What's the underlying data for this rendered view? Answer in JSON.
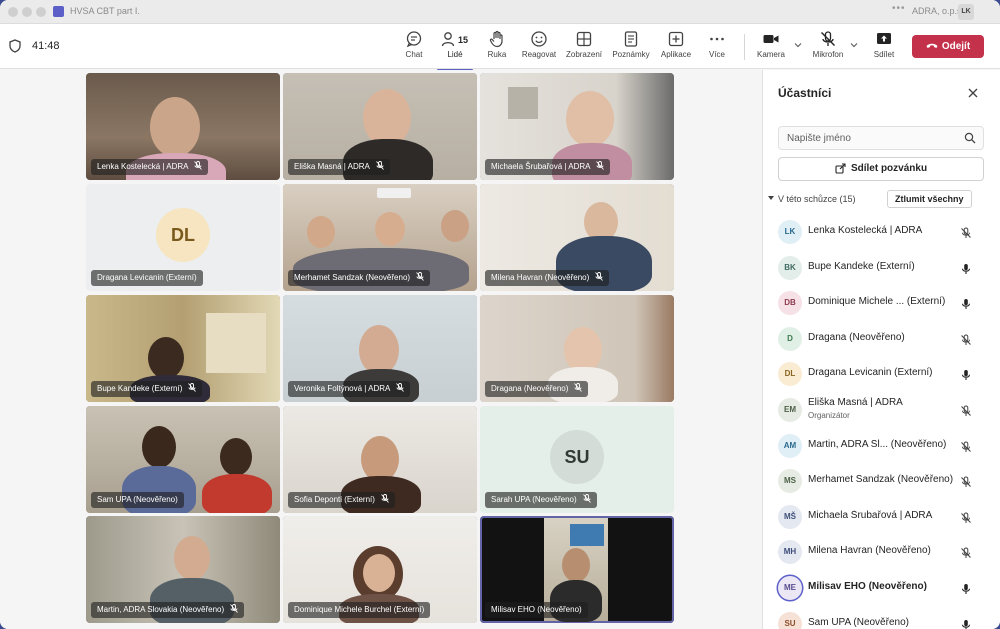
{
  "titlebar": {
    "title": "HVSA CBT part I.",
    "org": "ADRA, o.p.s.",
    "avatar": "LK"
  },
  "toolbar": {
    "timer": "41:48",
    "buttons": {
      "chat": "Chat",
      "people": "Lidé",
      "people_count": "15",
      "raise": "Ruka",
      "react": "Reagovat",
      "view": "Zobrazení",
      "notes": "Poznámky",
      "apps": "Aplikace",
      "more": "Více",
      "camera": "Kamera",
      "mic": "Mikrofon",
      "share": "Sdílet",
      "leave": "Odejít"
    }
  },
  "colors": {
    "accent": "#5b5fc7",
    "leave": "#c4314b",
    "active_speaker_border": "#6264a7"
  },
  "tiles": [
    {
      "name": "Lenka Kostelecká | ADRA",
      "mic": "muted"
    },
    {
      "name": "Eliška Masná | ADRA",
      "mic": "muted"
    },
    {
      "name": "Michaela Šrubařová | ADRA",
      "mic": "muted"
    },
    {
      "name": "Dragana Levicanin (Externí)",
      "mic": "none",
      "initials": "DL"
    },
    {
      "name": "Merhamet Sandzak (Neověřeno)",
      "mic": "muted"
    },
    {
      "name": "Milena Havran (Neověřeno)",
      "mic": "muted"
    },
    {
      "name": "Bupe Kandeke (Externí)",
      "mic": "muted"
    },
    {
      "name": "Veronika Foltýnová | ADRA",
      "mic": "muted"
    },
    {
      "name": "Dragana (Neověřeno)",
      "mic": "muted"
    },
    {
      "name": "Sam UPA (Neověřeno)",
      "mic": "none"
    },
    {
      "name": "Sofia Deponti (Externí)",
      "mic": "muted"
    },
    {
      "name": "Sarah UPA (Neověřeno)",
      "mic": "muted",
      "initials": "SU"
    },
    {
      "name": "Martin, ADRA Slovakia (Neověřeno)",
      "mic": "muted"
    },
    {
      "name": "Dominique Michele Burchel (Externí)",
      "mic": "none"
    },
    {
      "name": "Milisav EHO (Neověřeno)",
      "mic": "none"
    }
  ],
  "panel": {
    "title": "Účastníci",
    "search_placeholder": "Napište jméno",
    "share_invite": "Sdílet pozvánku",
    "section_label": "V této schůzce (15)",
    "mute_all": "Ztlumit všechny",
    "participants": [
      {
        "initials": "LK",
        "name": "Lenka Kostelecká | ADRA",
        "mic": "muted",
        "color": "#e0eef6",
        "text_color": "#2b6a8e"
      },
      {
        "initials": "BK",
        "name": "Bupe Kandeke (Externí)",
        "mic": "on",
        "color": "#e3eeeb",
        "text_color": "#3f6a5f"
      },
      {
        "initials": "DB",
        "name": "Dominique Michele ... (Externí)",
        "mic": "on",
        "color": "#f6e1e6",
        "text_color": "#8e3b4f"
      },
      {
        "initials": "D",
        "name": "Dragana (Neověřeno)",
        "mic": "muted",
        "color": "#e1f0e6",
        "text_color": "#3b7a4f"
      },
      {
        "initials": "DL",
        "name": "Dragana Levicanin (Externí)",
        "mic": "on",
        "color": "#f9ecd2",
        "text_color": "#8a6420"
      },
      {
        "initials": "EM",
        "name": "Eliška Masná | ADRA",
        "role": "Organizátor",
        "mic": "muted",
        "color": "#e6ebe4",
        "text_color": "#4d5f47"
      },
      {
        "initials": "AM",
        "name": "Martin, ADRA Sl... (Neověřeno)",
        "mic": "muted",
        "color": "#e0eef6",
        "text_color": "#2b6a8e"
      },
      {
        "initials": "MS",
        "name": "Merhamet Sandzak (Neověřeno)",
        "mic": "muted",
        "color": "#e6ebe4",
        "text_color": "#4d5f47"
      },
      {
        "initials": "MŠ",
        "name": "Michaela Šrubařová | ADRA",
        "mic": "muted",
        "color": "#e4e8f1",
        "text_color": "#3f4e7a"
      },
      {
        "initials": "MH",
        "name": "Milena Havran (Neověřeno)",
        "mic": "muted",
        "color": "#e4e8f1",
        "text_color": "#3f4e7a"
      },
      {
        "initials": "ME",
        "name": "Milisav EHO (Neověřeno)",
        "mic": "on",
        "color": "#ebe7f4",
        "text_color": "#5b4c8e",
        "speaking": true
      },
      {
        "initials": "SU",
        "name": "Sam UPA (Neověřeno)",
        "mic": "on",
        "color": "#f6e1d6",
        "text_color": "#8e4f2b"
      }
    ]
  }
}
